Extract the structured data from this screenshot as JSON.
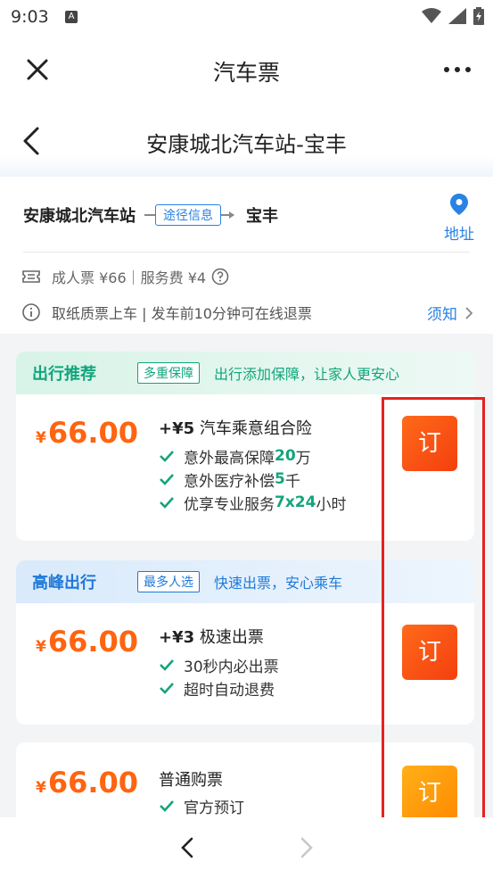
{
  "status_bar": {
    "time": "9:03",
    "notification_glyph": "A"
  },
  "app_header": {
    "title": "汽车票"
  },
  "route_header": {
    "title": "安康城北汽车站-宝丰"
  },
  "route_info": {
    "from_station": "安康城北汽车站",
    "via_label": "途径信息",
    "to_station": "宝丰",
    "address_label": "地址",
    "fare_text": "成人票 ¥66｜服务费 ¥4",
    "notice_text": "取纸质票上车 | 发车前10分钟可在线退票",
    "notice_link": "须知"
  },
  "products": [
    {
      "head_title": "出行推荐",
      "head_tag": "多重保障",
      "head_slogan": "出行添加保障，让家人更安心",
      "price_symbol": "¥",
      "price_value": "66.00",
      "plan_prefix": "+¥5",
      "plan_title": " 汽车乘意组合险",
      "bullets": [
        {
          "text": "意外最高保障",
          "highlight": "20",
          "suffix": "万"
        },
        {
          "text": "意外医疗补偿",
          "highlight": "5",
          "suffix": "千"
        },
        {
          "text": "优享专业服务",
          "highlight": "7x24",
          "suffix": "小时"
        }
      ],
      "button_label": "订"
    },
    {
      "head_title": "高峰出行",
      "head_tag": "最多人选",
      "head_slogan": "快速出票，安心乘车",
      "price_symbol": "¥",
      "price_value": "66.00",
      "plan_prefix": "+¥3",
      "plan_title": " 极速出票",
      "bullets": [
        {
          "text": "30秒内必出票"
        },
        {
          "text": "超时自动退费"
        }
      ],
      "button_label": "订"
    },
    {
      "price_symbol": "¥",
      "price_value": "66.00",
      "plan_title": "普通购票",
      "bullets": [
        {
          "text": "官方预订"
        }
      ],
      "button_label": "订"
    }
  ],
  "colors": {
    "accent_blue": "#2a82e4",
    "price_orange": "#ff6410",
    "green": "#12a57c",
    "highlight_red": "#e5221f"
  },
  "icons": {
    "close": "close-icon",
    "more": "more-icon",
    "back": "chevron-left-icon",
    "location": "location-pin-icon",
    "ticket": "ticket-icon",
    "info": "info-icon",
    "check": "check-icon"
  }
}
